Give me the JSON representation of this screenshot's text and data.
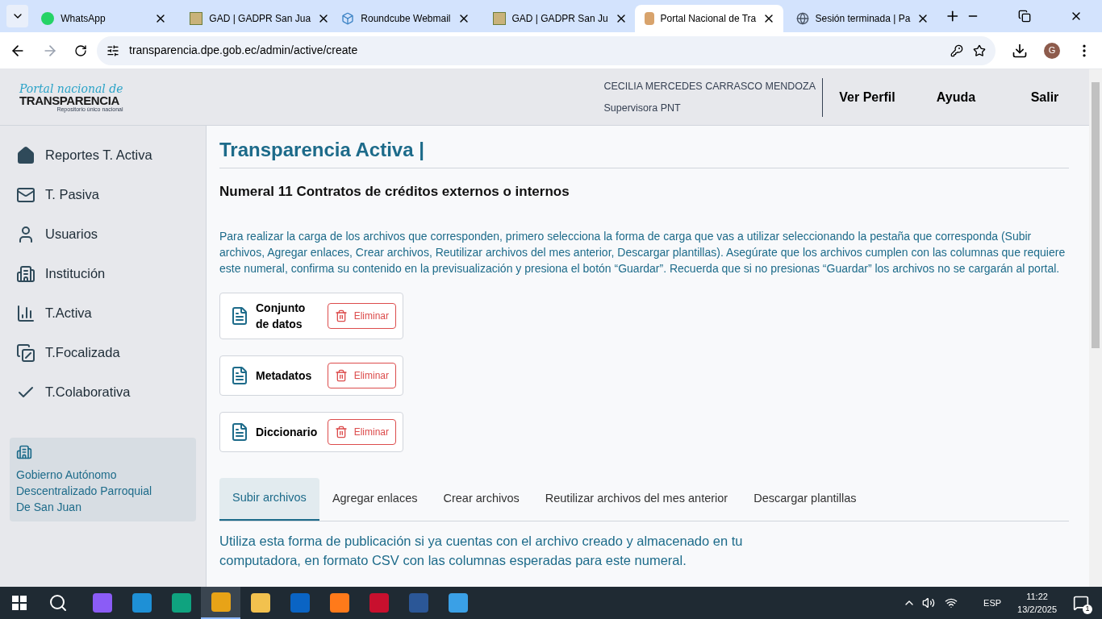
{
  "browser": {
    "tabs": [
      {
        "title": "WhatsApp",
        "kind": "whatsapp",
        "selected": false
      },
      {
        "title": "GAD | GADPR San Jua",
        "kind": "gad",
        "selected": false
      },
      {
        "title": "Roundcube Webmail",
        "kind": "cube",
        "selected": false
      },
      {
        "title": "GAD | GADPR San Ju",
        "kind": "gad",
        "selected": false
      },
      {
        "title": "Portal Nacional de Tra",
        "kind": "portal",
        "selected": true
      },
      {
        "title": "Sesión terminada | Pa",
        "kind": "globe",
        "selected": false
      }
    ],
    "url": "transparencia.dpe.gob.ec/admin/active/create",
    "profile": "G"
  },
  "header": {
    "logo": {
      "script": "Portal nacional de",
      "name": "TRANSPARENCIA",
      "tagline": "Repositorio único nacional"
    },
    "user_name": "CECILIA MERCEDES CARRASCO MENDOZA",
    "user_role": "Supervisora PNT",
    "links": [
      "Ver Perfil",
      "Ayuda",
      "Salir"
    ]
  },
  "sidebar": {
    "items": [
      {
        "label": "Reportes T. Activa",
        "kind": "home"
      },
      {
        "label": "T. Pasiva",
        "kind": "mail"
      },
      {
        "label": "Usuarios",
        "kind": "user"
      },
      {
        "label": "Institución",
        "kind": "building"
      },
      {
        "label": "T.Activa",
        "kind": "chart"
      },
      {
        "label": "T.Focalizada",
        "kind": "focus"
      },
      {
        "label": "T.Colaborativa",
        "kind": "check"
      }
    ],
    "institution": "Gobierno Autónomo Descentralizado Parroquial De San Juan"
  },
  "main": {
    "title": "Transparencia Activa |",
    "subtitle": "Numeral 11 Contratos de créditos externos o internos",
    "instructions": "Para realizar la carga de los archivos que corresponden, primero selecciona la forma de carga que vas a utilizar seleccionando la pestaña que corresponda (Subir archivos, Agregar enlaces, Crear archivos, Reutilizar archivos del mes anterior, Descargar plantillas). Asegúrate que los archivos cumplen con las columnas que requiere este numeral, confirma su contenido en la previsualización y presiona el botón “Guardar”. Recuerda que si no presionas “Guardar” los archivos no se cargarán al portal.",
    "files": [
      {
        "label": "Conjunto de datos",
        "button": "Eliminar"
      },
      {
        "label": "Metadatos",
        "button": "Eliminar"
      },
      {
        "label": "Diccionario",
        "button": "Eliminar"
      }
    ],
    "tabs": [
      {
        "label": "Subir archivos",
        "selected": true
      },
      {
        "label": "Agregar enlaces",
        "selected": false
      },
      {
        "label": "Crear archivos",
        "selected": false
      },
      {
        "label": "Reutilizar archivos del mes anterior",
        "selected": false
      },
      {
        "label": "Descargar plantillas",
        "selected": false
      }
    ],
    "tab_text": "Utiliza esta forma de publicación si ya cuentas con el archivo creado y almacenado en tu computadora, en formato CSV con las columnas esperadas para este numeral."
  },
  "taskbar": {
    "apps": [
      {
        "kind": "copilot",
        "selected": false
      },
      {
        "kind": "ie",
        "selected": false
      },
      {
        "kind": "edge",
        "selected": false
      },
      {
        "kind": "chrome",
        "selected": true
      },
      {
        "kind": "folder",
        "selected": false
      },
      {
        "kind": "outlook",
        "selected": false
      },
      {
        "kind": "firefox",
        "selected": false
      },
      {
        "kind": "pdf",
        "selected": false
      },
      {
        "kind": "word",
        "selected": false
      },
      {
        "kind": "photos",
        "selected": false
      }
    ],
    "language": "ESP",
    "time": "11:22",
    "date": "13/2/2025",
    "notifications": "1"
  }
}
